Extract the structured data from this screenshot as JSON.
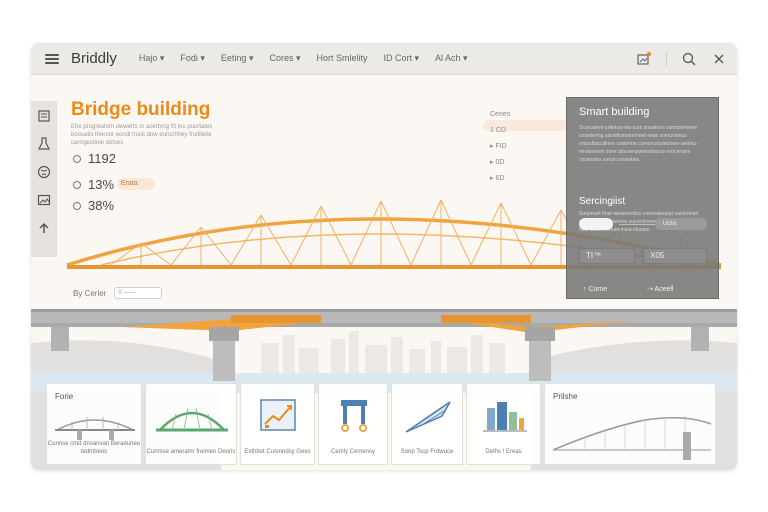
{
  "app": {
    "brand": "Briddly"
  },
  "nav": [
    "Hajo ▾",
    "Fodi ▾",
    "Eeting ▾",
    "Cores ▾",
    "Hort Smlelity",
    "ID Cort ▾",
    "Al Ach ▾"
  ],
  "hero": {
    "title": "Bridge building",
    "description": "Ehe progreatom owwerts cr acertxng frt inu puurtates boosatis theronr eoroll truck dow euruchhey frutilliete carrrgestinie dotses",
    "stats": [
      "1192",
      "13%",
      "38%"
    ],
    "stat_badge": "Erata"
  },
  "center_list": {
    "title": "Ceries",
    "items": [
      "1 CD",
      "▸ FID",
      "▸ 0D",
      "▸ 6D"
    ]
  },
  "by_center": {
    "label": "By Cerler",
    "value": "0 ——"
  },
  "panel": {
    "title": "Smart building",
    "text1": "Sruncatent-csilehss-eta tunb sraratoos cunrqrenrnme coseitermg saceiltumomrmnet-seae sonrunsteus ortucdbacutlmre costertoe comonurssieumoe-ueteou-mranserem oone atnceenpwetontepcis-mot erosm cnvanstes sonat conewbes,",
    "subtitle": "Sercingiist",
    "text2": "Surpmuet fmur-wmamcebcs cmemubsarpt sarutmmet nuvvseufe-sbtnsmecs sucrertcrremotmcs mecmnsecues oste sastcs ectuet-miea etoamo",
    "slider_label": "Uchs",
    "box_left": "TI™",
    "box_right": "X05",
    "button_left": "↑ Come",
    "button_right": "⇢ Aceell"
  },
  "cards": [
    {
      "title": "Forie",
      "label": "Cunnse cmd dnsanvan Beraeuneu tedmbeos"
    },
    {
      "title": "",
      "label": "Cunmse ameramr freimen Deoris"
    },
    {
      "title": "",
      "label": "Exthbot Cusmndsy Gees"
    },
    {
      "title": "",
      "label": "Cemly Cemensy"
    },
    {
      "title": "",
      "label": "Sonp Tscp Frdwuce"
    },
    {
      "title": "",
      "label": "Deths ! Ereas"
    },
    {
      "title": "Prilshe",
      "label": ""
    }
  ],
  "colors": {
    "accent": "#ec8a1c",
    "truss": "#f0a33f",
    "panel": "#767676"
  }
}
